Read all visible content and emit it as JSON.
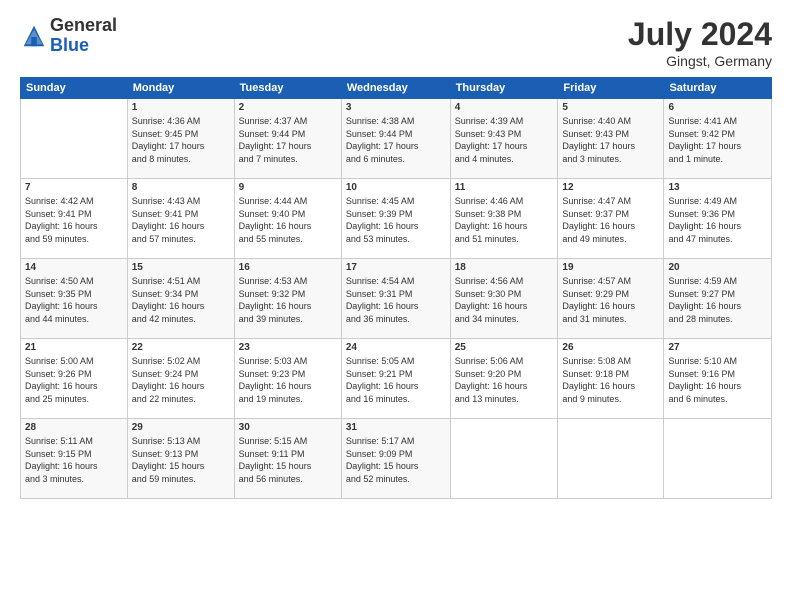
{
  "logo": {
    "general": "General",
    "blue": "Blue"
  },
  "header": {
    "month": "July 2024",
    "location": "Gingst, Germany"
  },
  "columns": [
    "Sunday",
    "Monday",
    "Tuesday",
    "Wednesday",
    "Thursday",
    "Friday",
    "Saturday"
  ],
  "weeks": [
    [
      {
        "day": "",
        "info": ""
      },
      {
        "day": "1",
        "info": "Sunrise: 4:36 AM\nSunset: 9:45 PM\nDaylight: 17 hours\nand 8 minutes."
      },
      {
        "day": "2",
        "info": "Sunrise: 4:37 AM\nSunset: 9:44 PM\nDaylight: 17 hours\nand 7 minutes."
      },
      {
        "day": "3",
        "info": "Sunrise: 4:38 AM\nSunset: 9:44 PM\nDaylight: 17 hours\nand 6 minutes."
      },
      {
        "day": "4",
        "info": "Sunrise: 4:39 AM\nSunset: 9:43 PM\nDaylight: 17 hours\nand 4 minutes."
      },
      {
        "day": "5",
        "info": "Sunrise: 4:40 AM\nSunset: 9:43 PM\nDaylight: 17 hours\nand 3 minutes."
      },
      {
        "day": "6",
        "info": "Sunrise: 4:41 AM\nSunset: 9:42 PM\nDaylight: 17 hours\nand 1 minute."
      }
    ],
    [
      {
        "day": "7",
        "info": "Sunrise: 4:42 AM\nSunset: 9:41 PM\nDaylight: 16 hours\nand 59 minutes."
      },
      {
        "day": "8",
        "info": "Sunrise: 4:43 AM\nSunset: 9:41 PM\nDaylight: 16 hours\nand 57 minutes."
      },
      {
        "day": "9",
        "info": "Sunrise: 4:44 AM\nSunset: 9:40 PM\nDaylight: 16 hours\nand 55 minutes."
      },
      {
        "day": "10",
        "info": "Sunrise: 4:45 AM\nSunset: 9:39 PM\nDaylight: 16 hours\nand 53 minutes."
      },
      {
        "day": "11",
        "info": "Sunrise: 4:46 AM\nSunset: 9:38 PM\nDaylight: 16 hours\nand 51 minutes."
      },
      {
        "day": "12",
        "info": "Sunrise: 4:47 AM\nSunset: 9:37 PM\nDaylight: 16 hours\nand 49 minutes."
      },
      {
        "day": "13",
        "info": "Sunrise: 4:49 AM\nSunset: 9:36 PM\nDaylight: 16 hours\nand 47 minutes."
      }
    ],
    [
      {
        "day": "14",
        "info": "Sunrise: 4:50 AM\nSunset: 9:35 PM\nDaylight: 16 hours\nand 44 minutes."
      },
      {
        "day": "15",
        "info": "Sunrise: 4:51 AM\nSunset: 9:34 PM\nDaylight: 16 hours\nand 42 minutes."
      },
      {
        "day": "16",
        "info": "Sunrise: 4:53 AM\nSunset: 9:32 PM\nDaylight: 16 hours\nand 39 minutes."
      },
      {
        "day": "17",
        "info": "Sunrise: 4:54 AM\nSunset: 9:31 PM\nDaylight: 16 hours\nand 36 minutes."
      },
      {
        "day": "18",
        "info": "Sunrise: 4:56 AM\nSunset: 9:30 PM\nDaylight: 16 hours\nand 34 minutes."
      },
      {
        "day": "19",
        "info": "Sunrise: 4:57 AM\nSunset: 9:29 PM\nDaylight: 16 hours\nand 31 minutes."
      },
      {
        "day": "20",
        "info": "Sunrise: 4:59 AM\nSunset: 9:27 PM\nDaylight: 16 hours\nand 28 minutes."
      }
    ],
    [
      {
        "day": "21",
        "info": "Sunrise: 5:00 AM\nSunset: 9:26 PM\nDaylight: 16 hours\nand 25 minutes."
      },
      {
        "day": "22",
        "info": "Sunrise: 5:02 AM\nSunset: 9:24 PM\nDaylight: 16 hours\nand 22 minutes."
      },
      {
        "day": "23",
        "info": "Sunrise: 5:03 AM\nSunset: 9:23 PM\nDaylight: 16 hours\nand 19 minutes."
      },
      {
        "day": "24",
        "info": "Sunrise: 5:05 AM\nSunset: 9:21 PM\nDaylight: 16 hours\nand 16 minutes."
      },
      {
        "day": "25",
        "info": "Sunrise: 5:06 AM\nSunset: 9:20 PM\nDaylight: 16 hours\nand 13 minutes."
      },
      {
        "day": "26",
        "info": "Sunrise: 5:08 AM\nSunset: 9:18 PM\nDaylight: 16 hours\nand 9 minutes."
      },
      {
        "day": "27",
        "info": "Sunrise: 5:10 AM\nSunset: 9:16 PM\nDaylight: 16 hours\nand 6 minutes."
      }
    ],
    [
      {
        "day": "28",
        "info": "Sunrise: 5:11 AM\nSunset: 9:15 PM\nDaylight: 16 hours\nand 3 minutes."
      },
      {
        "day": "29",
        "info": "Sunrise: 5:13 AM\nSunset: 9:13 PM\nDaylight: 15 hours\nand 59 minutes."
      },
      {
        "day": "30",
        "info": "Sunrise: 5:15 AM\nSunset: 9:11 PM\nDaylight: 15 hours\nand 56 minutes."
      },
      {
        "day": "31",
        "info": "Sunrise: 5:17 AM\nSunset: 9:09 PM\nDaylight: 15 hours\nand 52 minutes."
      },
      {
        "day": "",
        "info": ""
      },
      {
        "day": "",
        "info": ""
      },
      {
        "day": "",
        "info": ""
      }
    ]
  ]
}
